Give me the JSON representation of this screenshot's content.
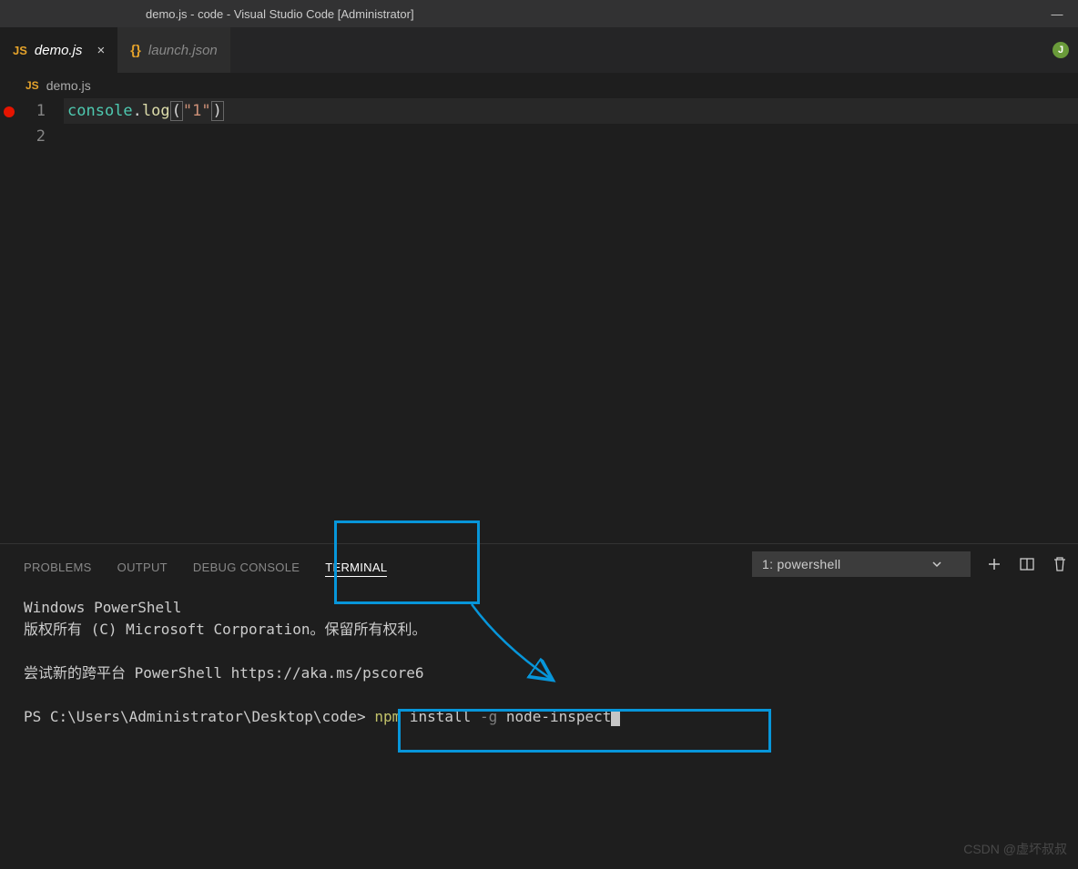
{
  "window": {
    "title": "demo.js - code - Visual Studio Code [Administrator]",
    "minimize": "—"
  },
  "tabs": {
    "active": {
      "icon": "JS",
      "label": "demo.js",
      "close": "×"
    },
    "inactive": {
      "icon": "{}",
      "label": "launch.json"
    }
  },
  "breadcrumb": {
    "icon": "JS",
    "label": "demo.js"
  },
  "editor": {
    "lines": [
      "1",
      "2"
    ],
    "code": {
      "obj": "console",
      "dot": ".",
      "fn": "log",
      "open": "(",
      "str": "\"1\"",
      "close": ")"
    }
  },
  "panel": {
    "tabs": {
      "problems": "PROBLEMS",
      "output": "OUTPUT",
      "debug": "DEBUG CONSOLE",
      "terminal": "TERMINAL"
    },
    "select_label": "1: powershell",
    "plus": "+",
    "terminal": {
      "line1": "Windows PowerShell",
      "line2": "版权所有 (C) Microsoft Corporation。保留所有权利。",
      "line3": "尝试新的跨平台 PowerShell https://aka.ms/pscore6",
      "prompt": "PS C:\\Users\\Administrator\\Desktop\\code> ",
      "cmd": "npm",
      "space": " ",
      "arg1": "install",
      "flag": "-g",
      "arg2": "node-inspect"
    }
  },
  "watermark": "CSDN @虚坏叔叔"
}
